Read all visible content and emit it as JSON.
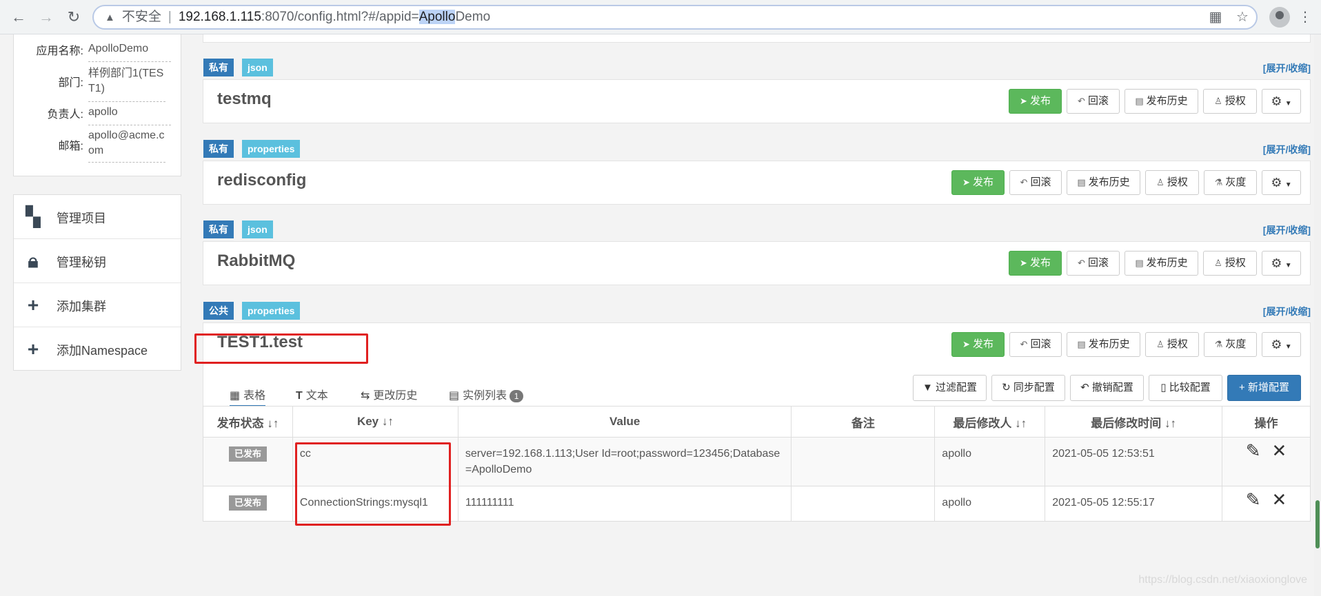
{
  "browser": {
    "warn_icon": "warning-icon",
    "insecure_label": "不安全",
    "separator": "|",
    "url_host": "192.168.1.115",
    "url_rest_pre": ":8070/config.html?#/appid=",
    "url_highlight": "Apollo",
    "url_rest_post": "Demo"
  },
  "app_info": {
    "name_label": "应用名称:",
    "name_value": "ApolloDemo",
    "dept_label": "部门:",
    "dept_value": "样例部门1(TEST1)",
    "owner_label": "负责人:",
    "owner_value": "apollo",
    "email_label": "邮箱:",
    "email_value": "apollo@acme.com"
  },
  "menu": [
    {
      "label": "管理项目",
      "icon": "dashboard-icon"
    },
    {
      "label": "管理秘钥",
      "icon": "lock-icon"
    },
    {
      "label": "添加集群",
      "icon": "plus-icon"
    },
    {
      "label": "添加Namespace",
      "icon": "plus-icon"
    }
  ],
  "namespaces": [
    {
      "scope": "私有",
      "format": "json",
      "name": "testmq",
      "toggle": "[展开/收缩]"
    },
    {
      "scope": "私有",
      "format": "properties",
      "name": "redisconfig",
      "toggle": "[展开/收缩]"
    },
    {
      "scope": "私有",
      "format": "json",
      "name": "RabbitMQ",
      "toggle": "[展开/收缩]"
    },
    {
      "scope": "公共",
      "format": "properties",
      "name": "TEST1.test",
      "toggle": "[展开/收缩]"
    }
  ],
  "buttons": {
    "publish": "发布",
    "rollback": "回滚",
    "history": "发布历史",
    "auth": "授权",
    "gray": "灰度"
  },
  "tabs": {
    "table": "表格",
    "text": "文本",
    "history": "更改历史",
    "instances": "实例列表",
    "instances_count": "1"
  },
  "toolbar": {
    "filter": "过滤配置",
    "sync": "同步配置",
    "revoke": "撤销配置",
    "compare": "比较配置",
    "add": "新增配置"
  },
  "table": {
    "headers": [
      "发布状态 ↓↑",
      "Key ↓↑",
      "Value",
      "备注",
      "最后修改人 ↓↑",
      "最后修改时间 ↓↑",
      "操作"
    ],
    "rows": [
      {
        "status": "已发布",
        "key": "cc",
        "value": "server=192.168.1.113;User Id=root;password=123456;Database=ApolloDemo",
        "comment": "",
        "modifier": "apollo",
        "time": "2021-05-05 12:53:51"
      },
      {
        "status": "已发布",
        "key": "ConnectionStrings:mysql1",
        "value": "111111111",
        "comment": "",
        "modifier": "apollo",
        "time": "2021-05-05 12:55:17"
      }
    ]
  },
  "watermark": "https://blog.csdn.net/xiaoxionglove"
}
